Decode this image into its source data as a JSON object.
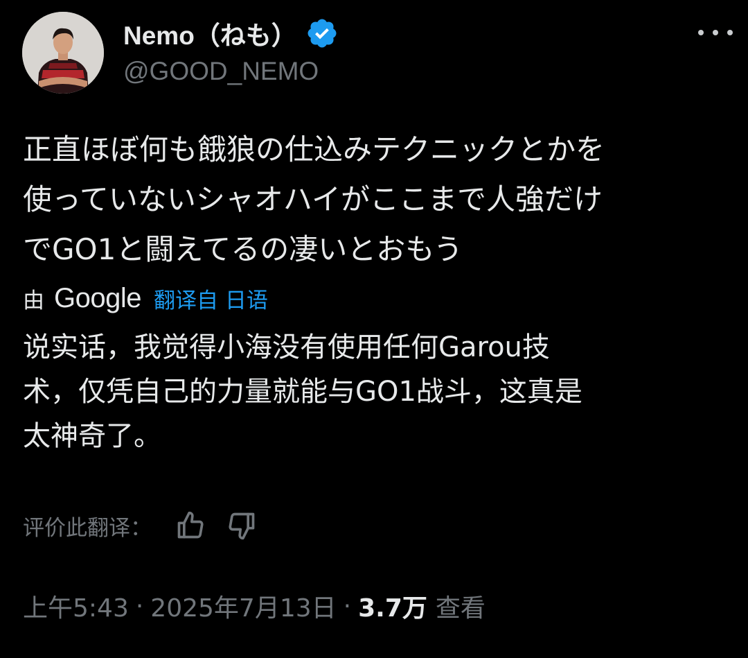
{
  "author": {
    "display_name": "Nemo（ねも）",
    "handle": "@GOOD_NEMO",
    "verified": true,
    "verified_color": "#1d9bf0"
  },
  "more_icon": "more-horizontal-icon",
  "tweet": {
    "lines": [
      "正直ほぼ何も餓狼の仕込みテクニックとかを",
      "使っていないシャオハイがここまで人強だけ",
      "でGO1と闘えてるの凄いとおもう"
    ]
  },
  "translation": {
    "by_prefix": "由",
    "provider": "Google",
    "link_label": "翻译自 日语",
    "link_color": "#1d9bf0",
    "lines": [
      "说实话，我觉得小海没有使用任何Garou技",
      "术，仅凭自己的力量就能与GO1战斗，这真是",
      "太神奇了。"
    ]
  },
  "rating": {
    "label": "评价此翻译：",
    "thumbs_up_icon": "thumbs-up-icon",
    "thumbs_down_icon": "thumbs-down-icon"
  },
  "meta": {
    "time": "上午5:43",
    "separator": "·",
    "date": "2025年7月13日",
    "views_count": "3.7万",
    "views_label": "查看"
  },
  "colors": {
    "background": "#000000",
    "primary_text": "#e7e9ea",
    "secondary_text": "#71767b",
    "accent": "#1d9bf0"
  }
}
